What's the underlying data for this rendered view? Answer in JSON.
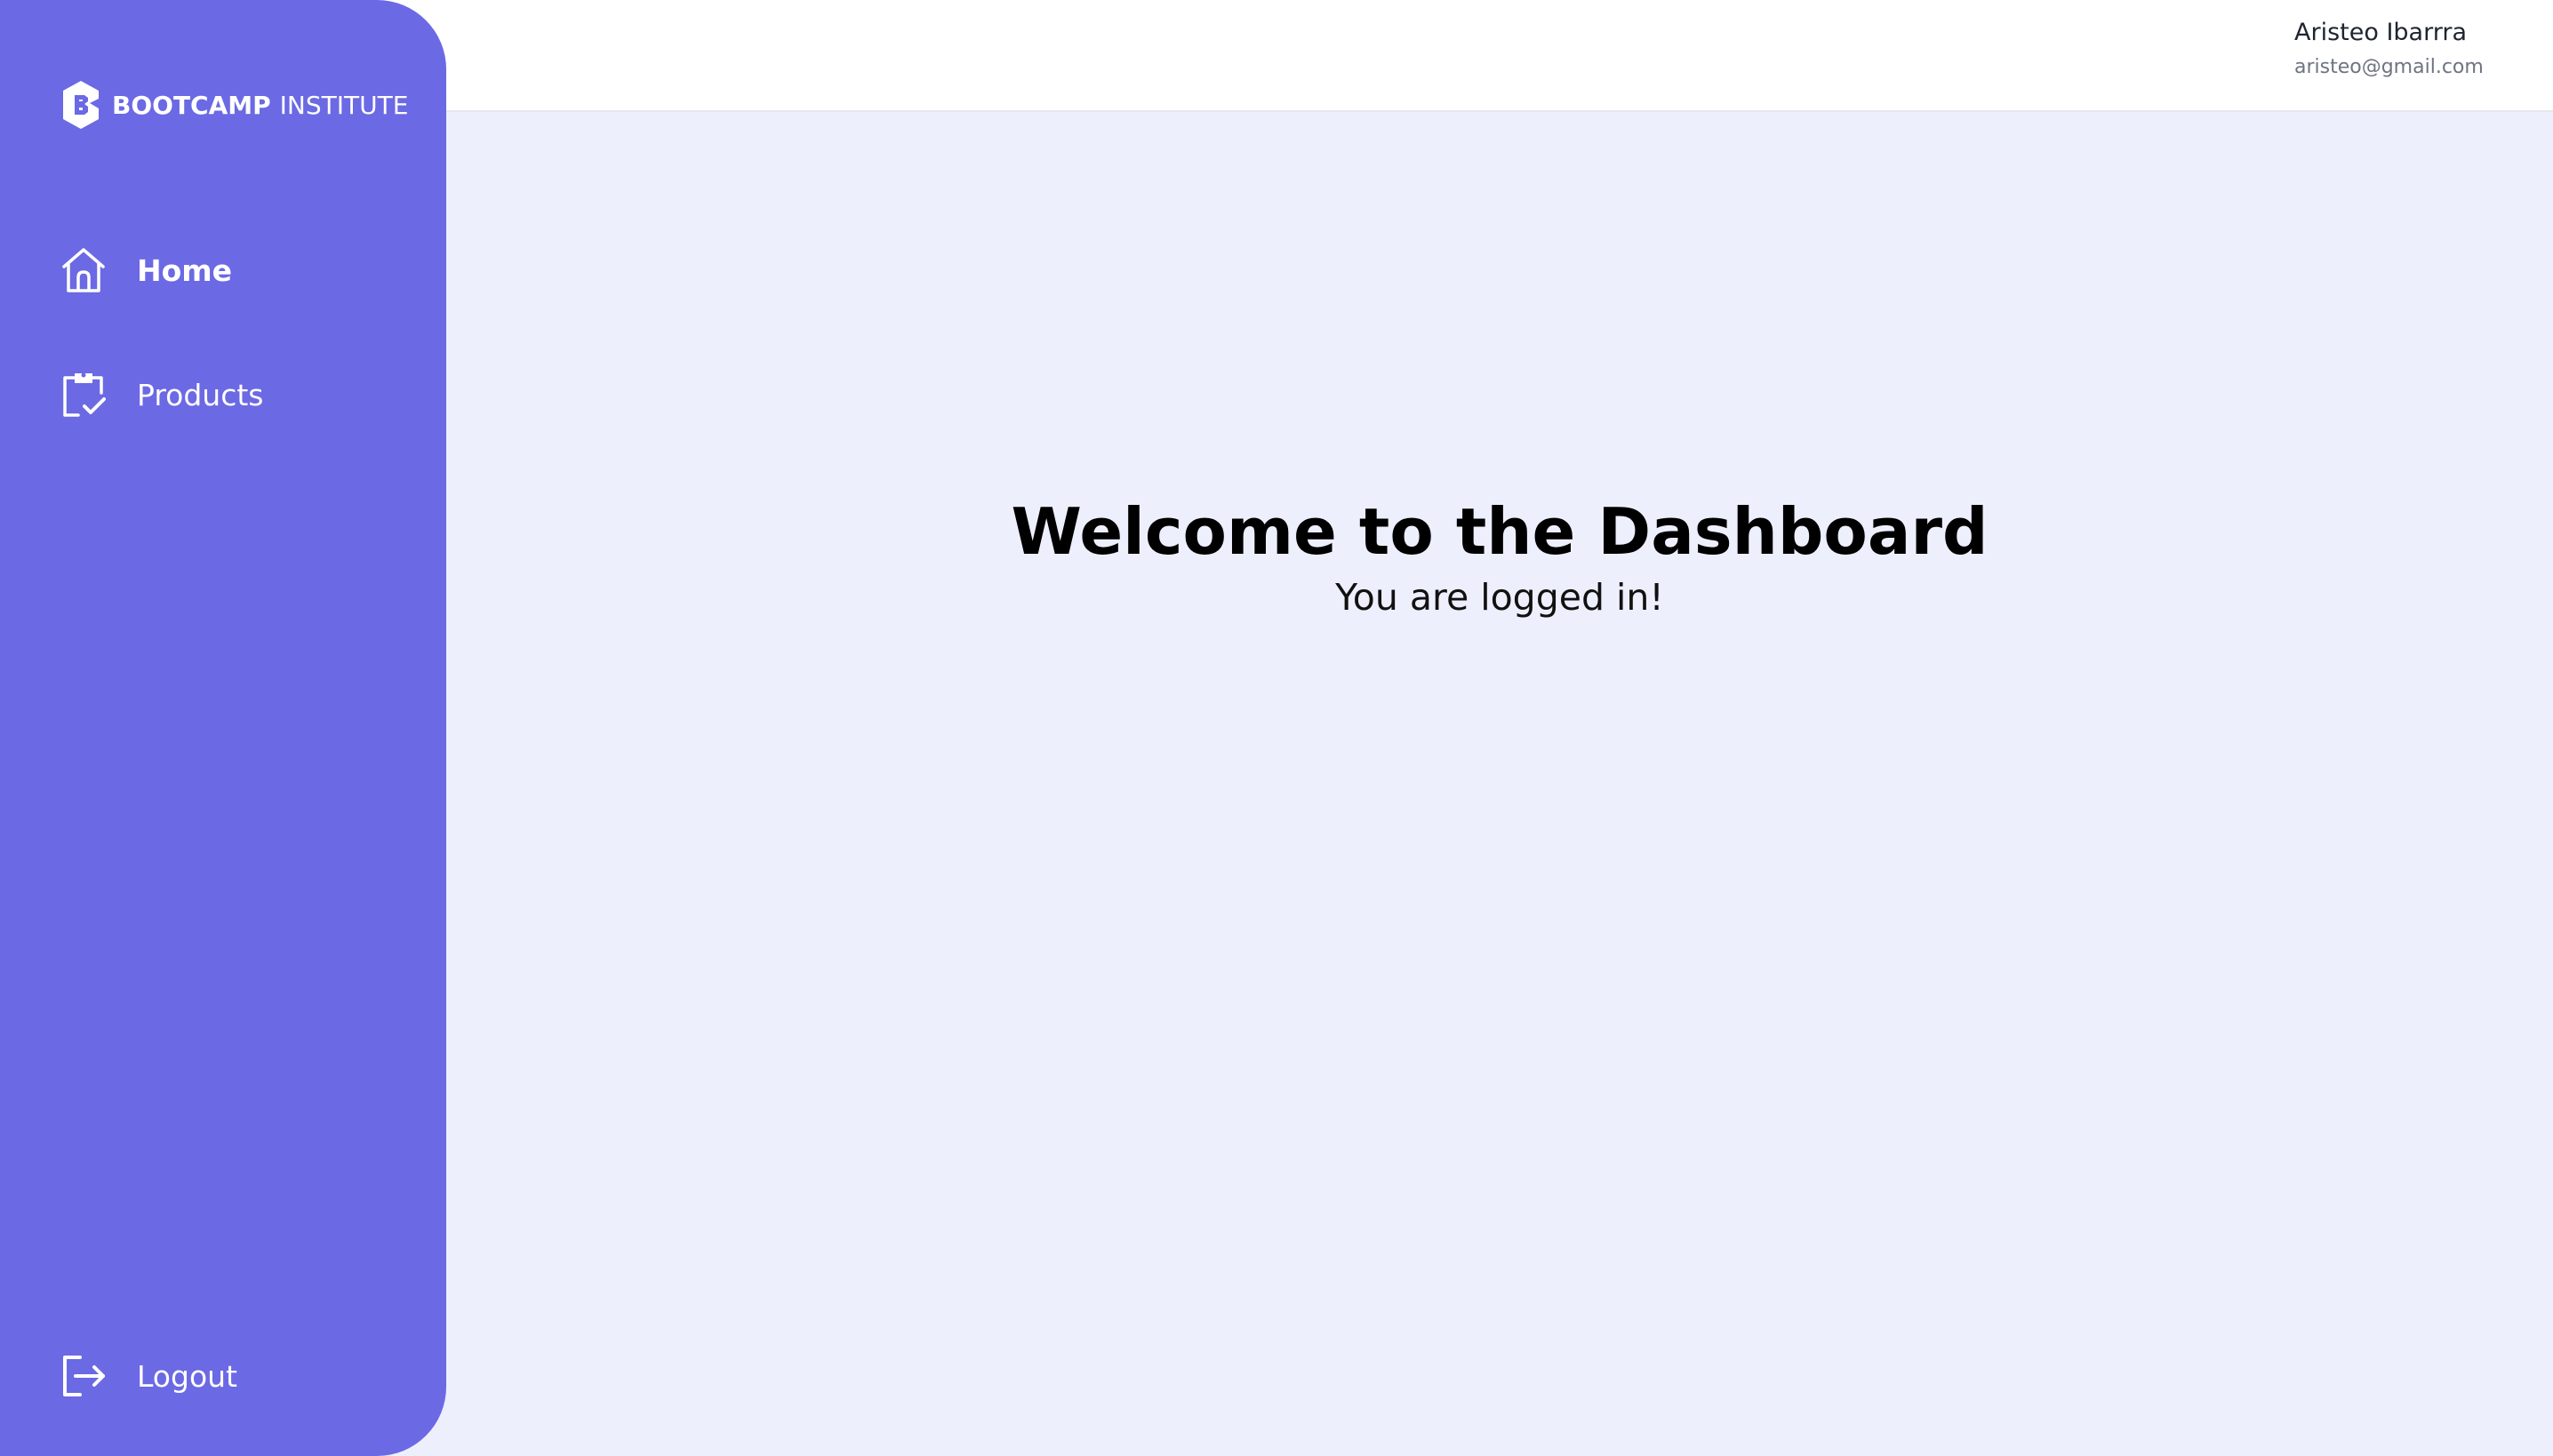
{
  "brand": {
    "name_bold": "BOOTCAMP",
    "name_light": "INSTITUTE",
    "logo_icon": "bootcamp-b-logo"
  },
  "sidebar": {
    "items": [
      {
        "label": "Home",
        "icon": "home-icon",
        "active": true
      },
      {
        "label": "Products",
        "icon": "clipboard-check-icon",
        "active": false
      }
    ],
    "logout": {
      "label": "Logout",
      "icon": "logout-icon"
    }
  },
  "user": {
    "name": "Aristeo Ibarrra",
    "email": "aristeo@gmail.com"
  },
  "main": {
    "title": "Welcome to the Dashboard",
    "subtitle": "You are logged in!"
  },
  "colors": {
    "sidebar": "#6b69e4",
    "background": "#edf0fc",
    "header": "#ffffff",
    "text": "#000000"
  }
}
